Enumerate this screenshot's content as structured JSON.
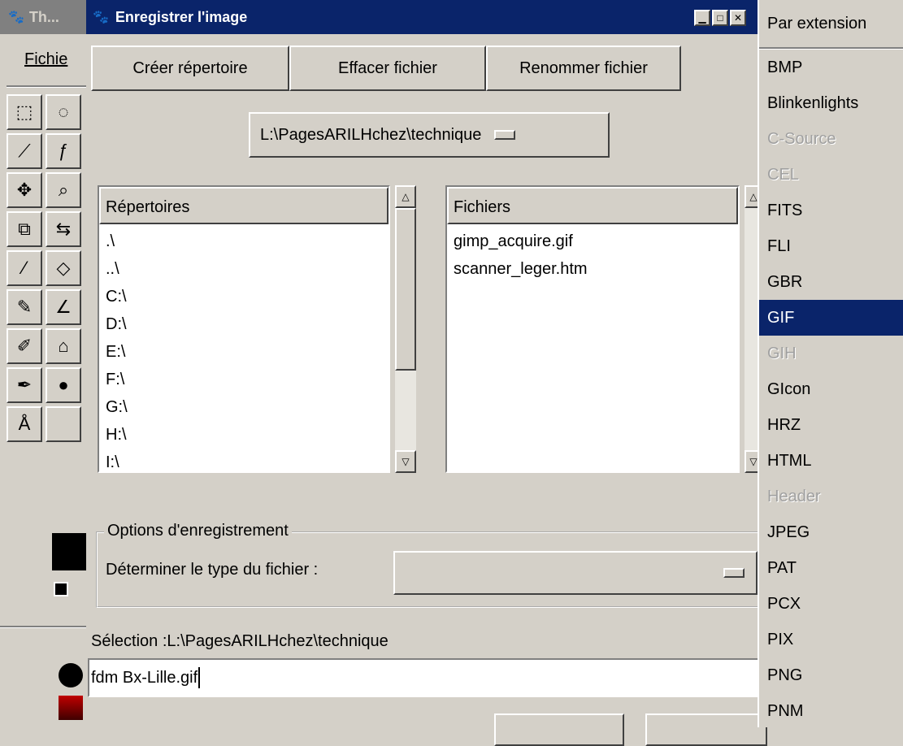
{
  "bg_window": {
    "title": "Th...",
    "menu_label": "Fichie"
  },
  "dialog": {
    "title": "Enregistrer l'image",
    "buttons": {
      "create_dir": "Créer répertoire",
      "delete_file": "Effacer fichier",
      "rename_file": "Renommer fichier"
    },
    "path_value": "L:\\PagesARILHchez\\technique",
    "directories": {
      "header": "Répertoires",
      "items": [
        ".\\",
        "..\\",
        "C:\\",
        "D:\\",
        "E:\\",
        "F:\\",
        "G:\\",
        "H:\\",
        "I:\\"
      ]
    },
    "files": {
      "header": "Fichiers",
      "items": [
        "gimp_acquire.gif",
        "scanner_leger.htm"
      ]
    },
    "options": {
      "legend": "Options d'enregistrement",
      "filetype_label": "Déterminer le type du fichier :",
      "filetype_value": ""
    },
    "selection": {
      "label": "Sélection :L:\\PagesARILHchez\\technique",
      "filename": "fdm Bx-Lille.gif"
    }
  },
  "format_menu": {
    "header": "Par extension",
    "items": [
      {
        "label": "BMP",
        "state": "normal"
      },
      {
        "label": "Blinkenlights",
        "state": "normal"
      },
      {
        "label": "C-Source",
        "state": "disabled"
      },
      {
        "label": "CEL",
        "state": "disabled"
      },
      {
        "label": "FITS",
        "state": "normal"
      },
      {
        "label": "FLI",
        "state": "normal"
      },
      {
        "label": "GBR",
        "state": "normal"
      },
      {
        "label": "GIF",
        "state": "selected"
      },
      {
        "label": "GIH",
        "state": "disabled"
      },
      {
        "label": "GIcon",
        "state": "normal"
      },
      {
        "label": "HRZ",
        "state": "normal"
      },
      {
        "label": "HTML",
        "state": "normal"
      },
      {
        "label": "Header",
        "state": "disabled"
      },
      {
        "label": "JPEG",
        "state": "normal"
      },
      {
        "label": "PAT",
        "state": "normal"
      },
      {
        "label": "PCX",
        "state": "normal"
      },
      {
        "label": "PIX",
        "state": "normal"
      },
      {
        "label": "PNG",
        "state": "normal"
      },
      {
        "label": "PNM",
        "state": "normal"
      }
    ]
  },
  "toolbox": {
    "tools": [
      [
        "rect-select-icon",
        "ellipse-select-icon"
      ],
      [
        "fuzzy-select-icon",
        "bezier-select-icon"
      ],
      [
        "move-icon",
        "magnify-icon"
      ],
      [
        "crop-icon",
        "flip-icon"
      ],
      [
        "color-picker-icon",
        "bucket-fill-icon"
      ],
      [
        "pencil-icon",
        "paintbrush-icon"
      ],
      [
        "clone-icon",
        "blend-icon"
      ],
      [
        "airbrush-icon",
        "ink-icon"
      ],
      [
        "measure-icon",
        ""
      ]
    ],
    "glyphs": {
      "rect-select-icon": "⬚",
      "ellipse-select-icon": "◌",
      "fuzzy-select-icon": "⟋",
      "bezier-select-icon": "ƒ",
      "move-icon": "✥",
      "magnify-icon": "⌕",
      "crop-icon": "⧉",
      "flip-icon": "⇆",
      "color-picker-icon": "⁄",
      "bucket-fill-icon": "◇",
      "pencil-icon": "✎",
      "paintbrush-icon": "∠",
      "clone-icon": "✐",
      "blend-icon": "⌂",
      "airbrush-icon": "✒",
      "ink-icon": "●",
      "measure-icon": "Å",
      "": ""
    }
  },
  "colors": {
    "title_active": "#0a246a",
    "face": "#d4d0c8",
    "selected": "#0a246a"
  }
}
